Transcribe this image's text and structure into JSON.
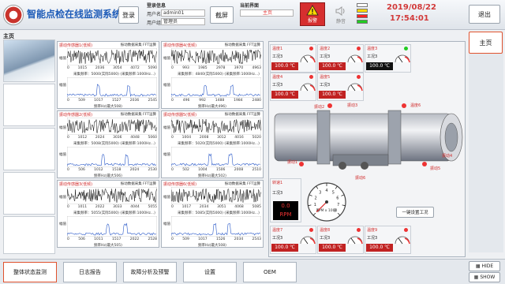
{
  "header": {
    "title": "智能点检在线监测系统",
    "login_btn": "登录",
    "login_info_label": "登录信息",
    "user_label": "用户名",
    "user_value": "admin01",
    "role_label": "用户组",
    "role_value": "管理员",
    "screenshot_btn": "截屏",
    "current_page_label": "当前界面",
    "current_page_value": "主页",
    "alarm_label": "报警",
    "mute_label": "静音",
    "date": "2019/08/22",
    "time": "17:54:01",
    "exit_btn": "退出",
    "indicator_colors": [
      "#ffffff",
      "#ffd800",
      "#ff2222",
      "#22cc22"
    ]
  },
  "sidebar": {
    "home_label": "主页",
    "main_btn": "主页"
  },
  "vibration_panels": [
    {
      "title": "振动传感器1(低频)",
      "legend_a": "振动数据采集",
      "legend_b": "FFT运算",
      "ylab": "幅值",
      "xticks": [
        "0",
        "1015",
        "2036",
        "3054",
        "4072",
        "5090"
      ],
      "freq_label": "采集频率：5000(实际5000) (采集频率:1000Hz...)",
      "fticks": [
        "0",
        "509",
        "1017",
        "1527",
        "2036",
        "2545"
      ],
      "fft_label": "频率Hz(最大508)"
    },
    {
      "title": "振动传感器4(低频)",
      "legend_a": "振动数据采集",
      "legend_b": "FFT运算",
      "ylab": "幅值",
      "xticks": [
        "0",
        "993",
        "1985",
        "2978",
        "3970",
        "4963"
      ],
      "freq_label": "采集频率：4840(实际5000) (采集频率:1000Hz...)",
      "fticks": [
        "0",
        "496",
        "992",
        "1488",
        "1984",
        "2480"
      ],
      "fft_label": "频率Hz(最大496)"
    },
    {
      "title": "振动传感器2(低频)",
      "legend_a": "振动数据采集",
      "legend_b": "FFT运算",
      "ylab": "幅值",
      "xticks": [
        "0",
        "1012",
        "2024",
        "3036",
        "4048",
        "5060"
      ],
      "freq_label": "采集频率：5008(实际5000) (采集频率:1000Hz...)",
      "fticks": [
        "0",
        "506",
        "1012",
        "1518",
        "2024",
        "2530"
      ],
      "fft_label": "频率Hz(最大506)"
    },
    {
      "title": "振动传感器5(低频)",
      "legend_a": "振动数据采集",
      "legend_b": "FFT运算",
      "ylab": "幅值",
      "xticks": [
        "0",
        "1004",
        "2008",
        "3012",
        "4016",
        "5020"
      ],
      "freq_label": "采集频率：5020(实际5000) (采集频率:1000Hz...)",
      "fticks": [
        "0",
        "502",
        "1004",
        "1506",
        "2008",
        "2510"
      ],
      "fft_label": "频率Hz(最大502)"
    },
    {
      "title": "振动传感器3(低频)",
      "legend_a": "振动数据采集",
      "legend_b": "FFT运算",
      "ylab": "幅值",
      "xticks": [
        "0",
        "1011",
        "2022",
        "3033",
        "4044",
        "5055"
      ],
      "freq_label": "采集频率：5055(实际5000) (采集频率:1000Hz...)",
      "fticks": [
        "0",
        "506",
        "1011",
        "1517",
        "2022",
        "2528"
      ],
      "fft_label": "频率Hz(最大505)"
    },
    {
      "title": "振动传感器6(低频)",
      "legend_a": "振动数据采集",
      "legend_b": "FFT运算",
      "ylab": "幅值",
      "xticks": [
        "0",
        "1017",
        "2034",
        "3051",
        "4068",
        "5085"
      ],
      "freq_label": "采集频率：5085(实际5000) (采集频率:1000Hz...)",
      "fticks": [
        "0",
        "509",
        "1017",
        "1526",
        "2034",
        "2543"
      ],
      "fft_label": "频率Hz(最大508)"
    }
  ],
  "temp_gauges_top": [
    {
      "name": "温度1",
      "cond": "工况3",
      "value": "100.0 ℃",
      "style": "red"
    },
    {
      "name": "温度2",
      "cond": "工况3",
      "value": "100.0 ℃",
      "style": "red"
    },
    {
      "name": "温度3",
      "cond": "工况3",
      "value": "100.0 ℃",
      "style": "black"
    },
    {
      "name": "温度4",
      "cond": "工况3",
      "value": "100.0 ℃",
      "style": "red"
    },
    {
      "name": "温度5",
      "cond": "工况3",
      "value": "100.0 ℃",
      "style": "red"
    }
  ],
  "temp_gauges_bottom": [
    {
      "name": "温度7",
      "cond": "工况3",
      "value": "100.0 ℃",
      "style": "red"
    },
    {
      "name": "温度8",
      "cond": "工况3",
      "value": "100.0 ℃",
      "style": "red"
    },
    {
      "name": "温度9",
      "cond": "工况3",
      "value": "100.0 ℃",
      "style": "red"
    }
  ],
  "tacho": {
    "name": "转速1",
    "cond": "工况3",
    "value": "0.0",
    "unit": "RPM",
    "dial_label": "RPM x 1000",
    "ticks": [
      "0",
      "1",
      "2",
      "3",
      "4",
      "5",
      "6",
      "7",
      "8"
    ]
  },
  "sensor_labels": [
    "振动1",
    "振动2",
    "振动3",
    "振动4",
    "振动5",
    "振动6",
    "温度6"
  ],
  "one_key_btn": "一键设置工况",
  "bottom_nav": [
    "整体状态监测",
    "日志报告",
    "故障分析及预警",
    "设置",
    "OEM"
  ],
  "hide_btn": "HIDE",
  "show_btn": "SHOW"
}
